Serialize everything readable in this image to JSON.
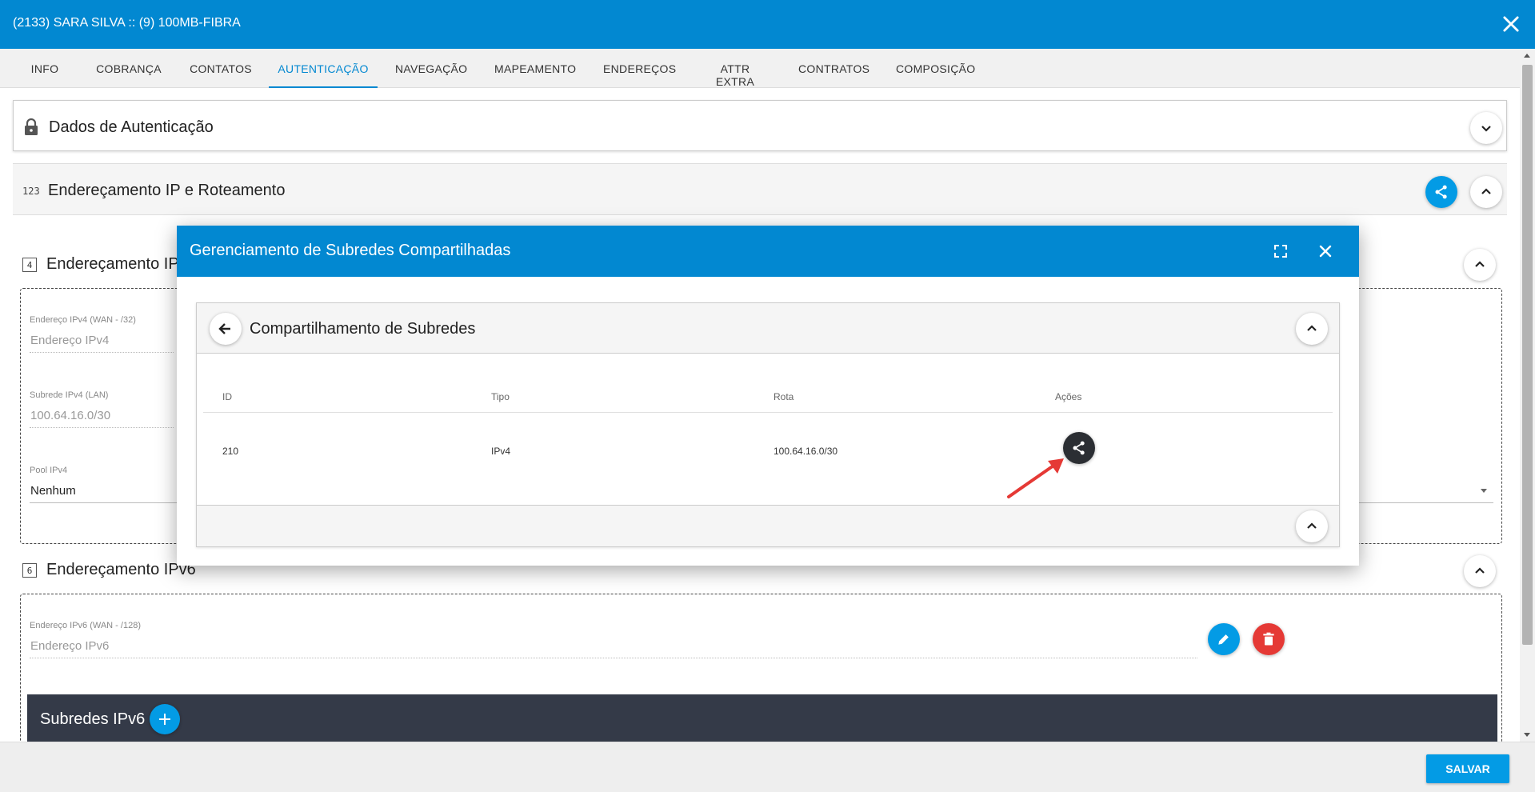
{
  "window": {
    "title": "(2133) SARA SILVA :: (9) 100MB-FIBRA"
  },
  "tabs": [
    {
      "label": "INFO"
    },
    {
      "label": "COBRANÇA"
    },
    {
      "label": "CONTATOS"
    },
    {
      "label": "AUTENTICAÇÃO",
      "active": true
    },
    {
      "label": "NAVEGAÇÃO"
    },
    {
      "label": "MAPEAMENTO"
    },
    {
      "label": "ENDEREÇOS"
    },
    {
      "label": "ATTR EXTRA"
    },
    {
      "label": "CONTRATOS"
    },
    {
      "label": "COMPOSIÇÃO"
    }
  ],
  "auth_panel": {
    "label": "Dados de Autenticação"
  },
  "ip_panel": {
    "label": "Endereçamento IP e Roteamento",
    "num_icon": "123",
    "ipv4": {
      "label": "Endereçamento IP",
      "icon_text": "4",
      "wan_label": "Endereço IPv4 (WAN - /32)",
      "wan_placeholder": "Endereço IPv4",
      "lan_label": "Subrede IPv4 (LAN)",
      "lan_value": "100.64.16.0/30",
      "pool_label": "Pool IPv4",
      "pool_value": "Nenhum"
    },
    "ipv6": {
      "label": "Endereçamento IPv6",
      "icon_text": "6",
      "wan_label": "Endereço IPv6 (WAN - /128)",
      "wan_placeholder": "Endereço IPv6"
    },
    "subredes_ipv6": {
      "label": "Subredes IPv6"
    }
  },
  "modal": {
    "title": "Gerenciamento de Subredes Compartilhadas",
    "card_title": "Compartilhamento de Subredes",
    "table": {
      "headers": [
        "ID",
        "Tipo",
        "Rota",
        "Ações"
      ],
      "rows": [
        {
          "id": "210",
          "tipo": "IPv4",
          "rota": "100.64.16.0/30"
        }
      ]
    }
  },
  "footer": {
    "save_label": "SALVAR"
  },
  "colors": {
    "primary": "#0288d1",
    "accent": "#039be5",
    "danger": "#e53935",
    "dark_bar": "#343a48"
  }
}
